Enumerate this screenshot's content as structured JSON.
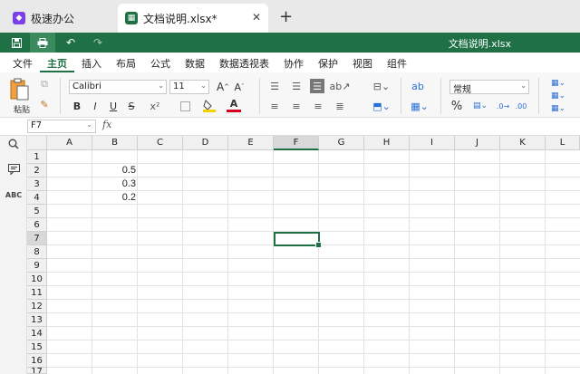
{
  "tabs": [
    {
      "title": "极速办公",
      "icon": "app-icon",
      "color": "#7b3fe4"
    },
    {
      "title": "文档说明.xlsx*",
      "icon": "spreadsheet-icon",
      "color": "#1f7145"
    }
  ],
  "window": {
    "title": "文档说明.xlsx",
    "accent": "#1f7145"
  },
  "menu": [
    "文件",
    "主页",
    "插入",
    "布局",
    "公式",
    "数据",
    "数据透视表",
    "协作",
    "保护",
    "视图",
    "组件"
  ],
  "ribbon": {
    "paste_label": "粘贴",
    "font_name": "Calibri",
    "font_size": "11",
    "number_format": "常规",
    "bold": "B",
    "italic": "I",
    "underline": "U",
    "strike": "S",
    "font_color_label": "A",
    "percent": "%"
  },
  "formula_bar": {
    "name_box": "F7",
    "fx": "fx",
    "formula": ""
  },
  "columns": [
    "A",
    "B",
    "C",
    "D",
    "E",
    "F",
    "G",
    "H",
    "I",
    "J",
    "K",
    "L"
  ],
  "rows": [
    "1",
    "2",
    "3",
    "4",
    "5",
    "6",
    "7",
    "8",
    "9",
    "10",
    "11",
    "12",
    "13",
    "14",
    "15",
    "16",
    "17"
  ],
  "selected": {
    "column": "F",
    "row": "7"
  },
  "cells": [
    {
      "ref": "B2",
      "value": "0.5"
    },
    {
      "ref": "B3",
      "value": "0.3"
    },
    {
      "ref": "B4",
      "value": "0.2"
    }
  ]
}
